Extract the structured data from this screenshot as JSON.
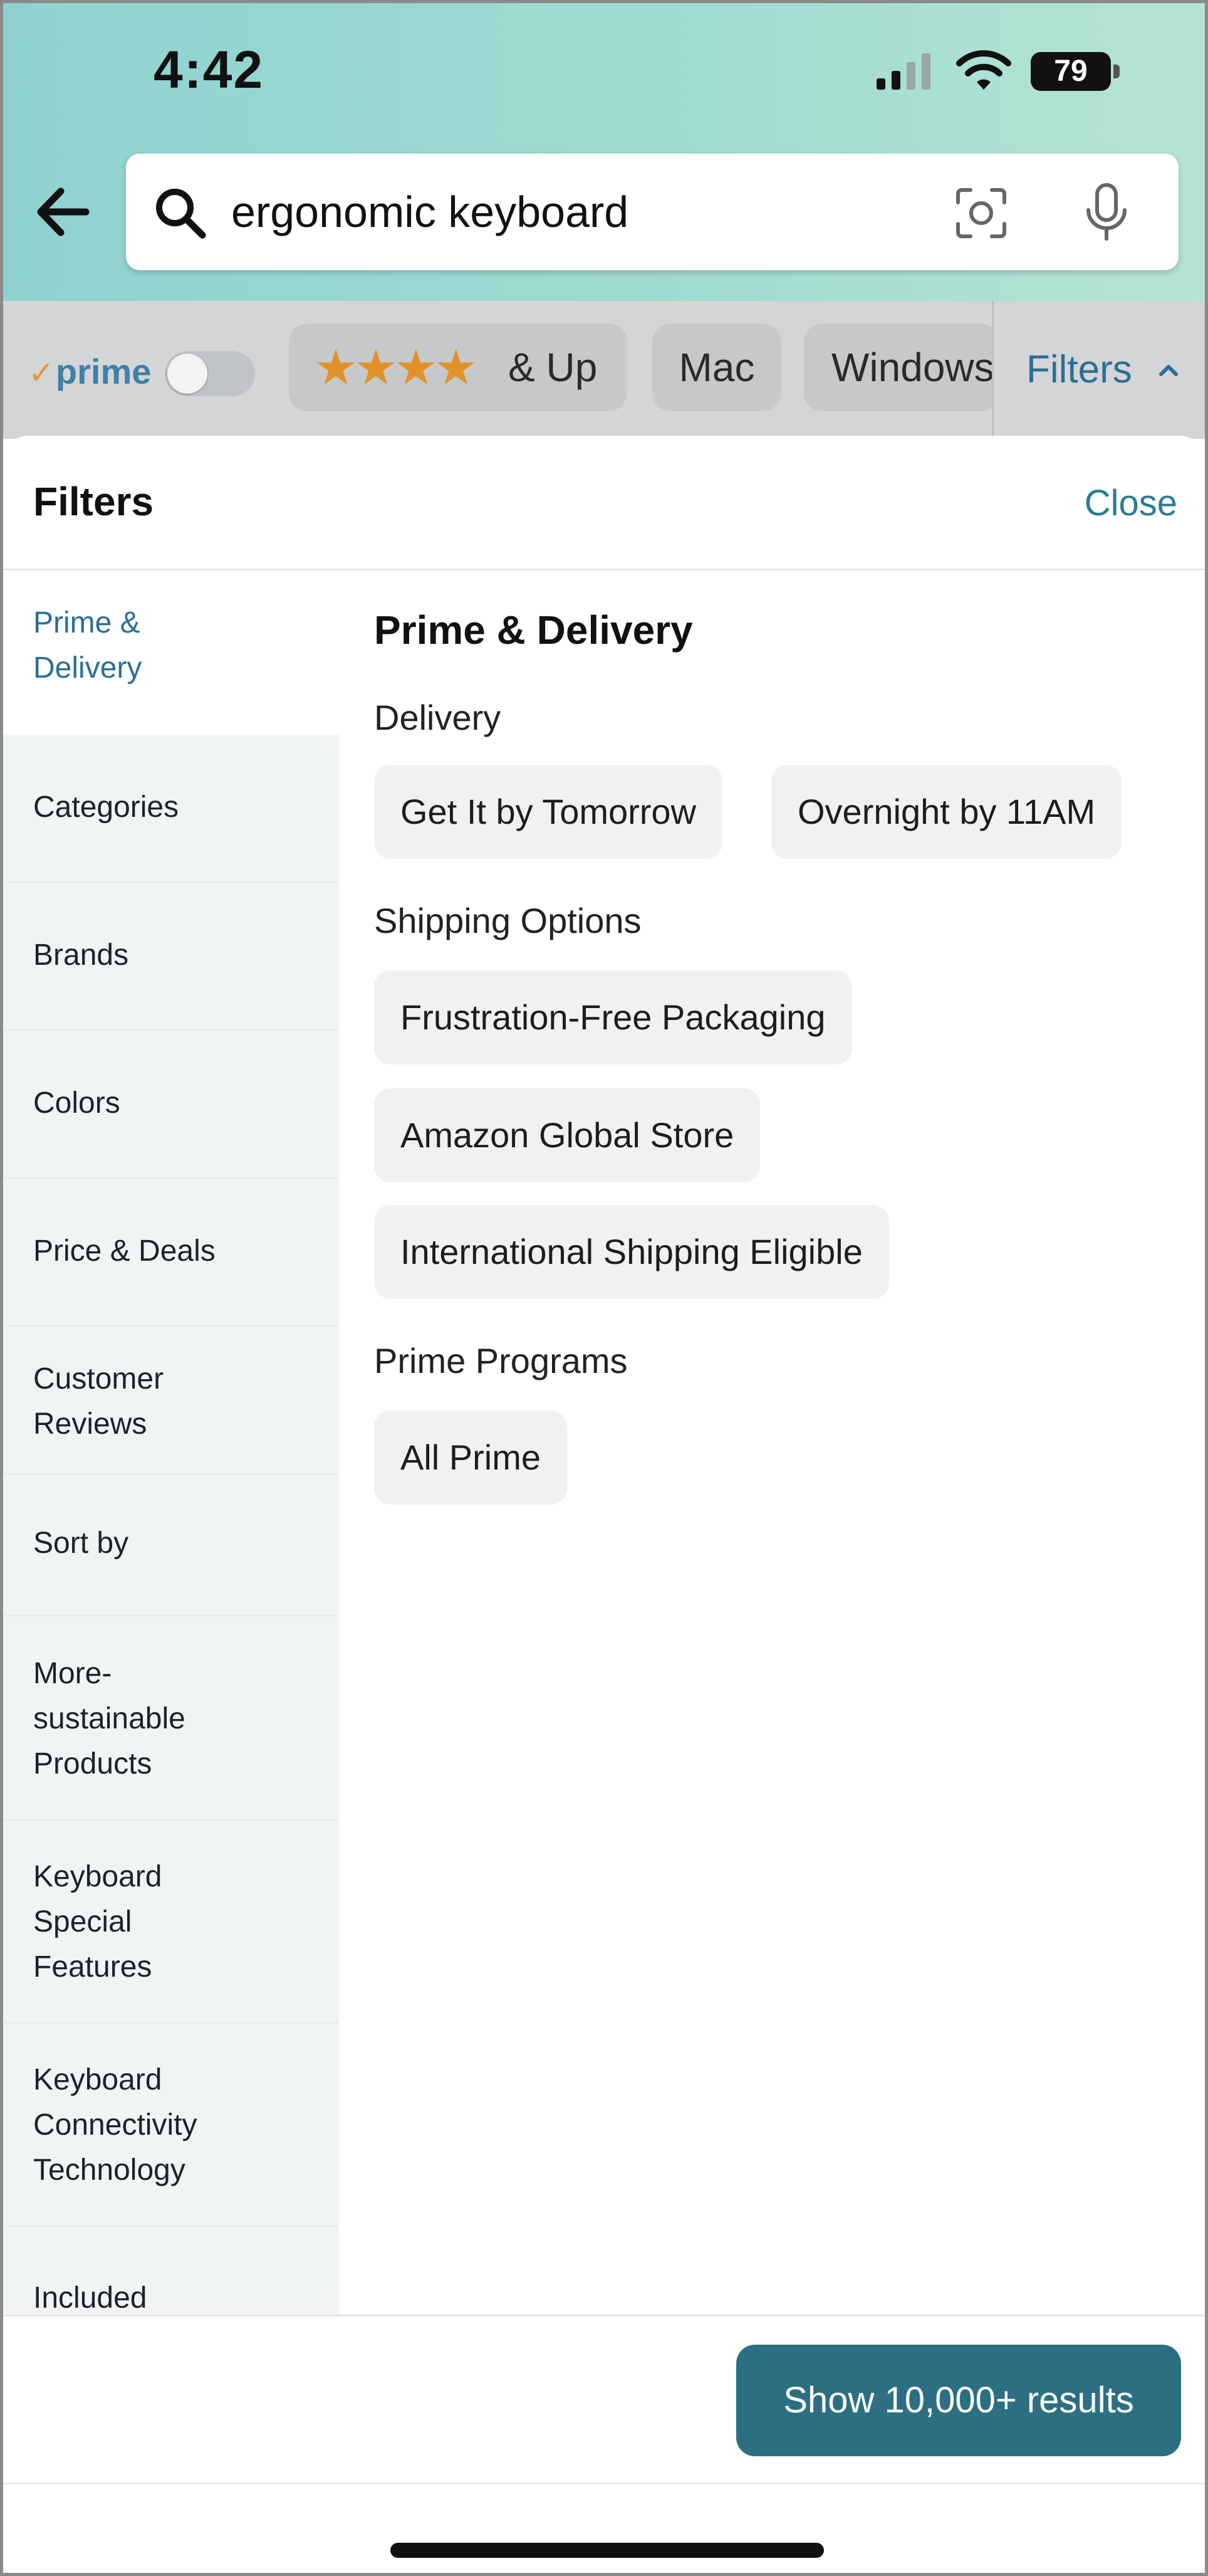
{
  "status_bar": {
    "time": "4:42",
    "battery": "79"
  },
  "search": {
    "query": "ergonomic keyboard"
  },
  "chip_bar": {
    "prime_label": "prime",
    "prime_check": "✓",
    "prime_toggle_on": false,
    "stars_chip": {
      "stars": "★★★★",
      "label": "& Up"
    },
    "chips": [
      "Mac",
      "Windows"
    ],
    "filters_label": "Filters"
  },
  "panel": {
    "title": "Filters",
    "close_label": "Close",
    "nav": [
      {
        "label": "Prime &\nDelivery",
        "active": true
      },
      {
        "label": "Categories",
        "active": false
      },
      {
        "label": "Brands",
        "active": false
      },
      {
        "label": "Colors",
        "active": false
      },
      {
        "label": "Price & Deals",
        "active": false
      },
      {
        "label": "Customer\nReviews",
        "active": false
      },
      {
        "label": "Sort by",
        "active": false
      },
      {
        "label": "More-\nsustainable\nProducts",
        "active": false
      },
      {
        "label": "Keyboard\nSpecial\nFeatures",
        "active": false
      },
      {
        "label": "Keyboard\nConnectivity\nTechnology",
        "active": false
      },
      {
        "label": "Included",
        "active": false
      }
    ],
    "content": {
      "heading": "Prime & Delivery",
      "sections": [
        {
          "label": "Delivery",
          "options": [
            "Get It by Tomorrow",
            "Overnight by 11AM"
          ]
        },
        {
          "label": "Shipping Options",
          "options": [
            "Frustration-Free Packaging",
            "Amazon Global Store",
            "International Shipping Eligible"
          ]
        },
        {
          "label": "Prime Programs",
          "options": [
            "All Prime"
          ]
        }
      ]
    },
    "show_results_label": "Show 10,000+ results"
  },
  "colors": {
    "accent": "#2b6f93",
    "primary_button": "#2c6f83",
    "star": "#e0912a",
    "prime_check": "#e5953a"
  },
  "icons": {
    "back": "arrow-left-icon",
    "search": "search-icon",
    "camera": "camera-lens-icon",
    "mic": "microphone-icon",
    "chevron": "chevron-up-icon",
    "signal": "cellular-signal-icon",
    "wifi": "wifi-icon",
    "battery": "battery-icon"
  }
}
